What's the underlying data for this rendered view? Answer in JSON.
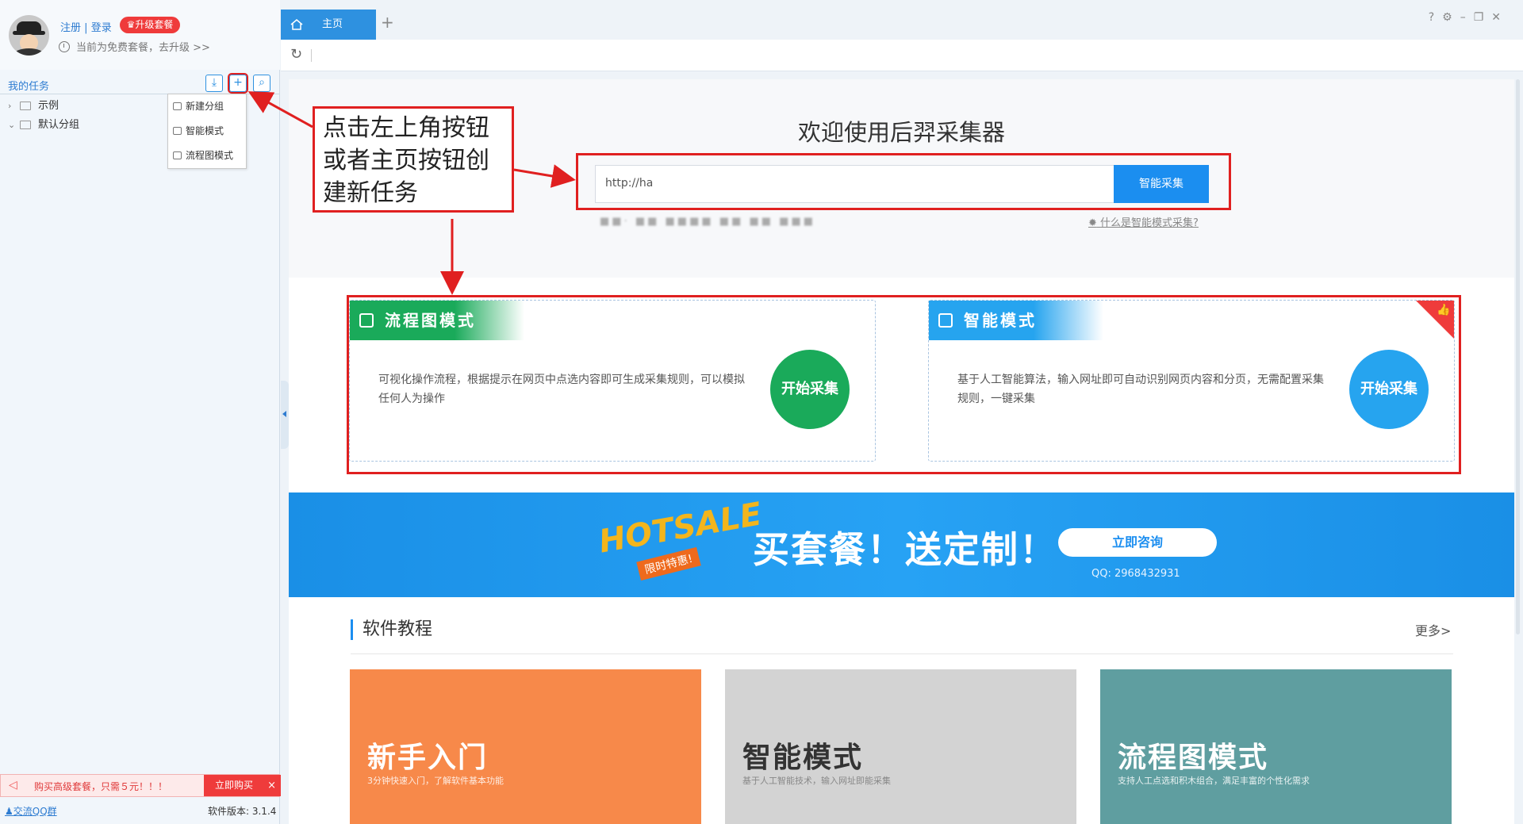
{
  "user": {
    "register": "注册",
    "sep": "|",
    "login": "登录",
    "upgrade": "升级套餐",
    "plan_text": "当前为免费套餐，去升级 >>"
  },
  "sidebar": {
    "title": "我的任务",
    "tools": [
      "import-icon",
      "add-task-icon",
      "search-icon"
    ],
    "tree": [
      {
        "label": "示例"
      },
      {
        "label": "默认分组"
      }
    ],
    "context_menu": [
      "新建分组",
      "智能模式",
      "流程图模式"
    ],
    "promo_text": "购买高级套餐，只需５元！！！",
    "promo_buy": "立即购买",
    "promo_close": "×",
    "qq_group": "交流QQ群",
    "version": "软件版本: 3.1.4"
  },
  "tabs": {
    "home": "主页",
    "add": "+"
  },
  "window_controls": [
    "?",
    "⚙",
    "–",
    "❐",
    "✕"
  ],
  "hero": {
    "title": "欢迎使用后羿采集器",
    "url_value": "http://ha",
    "smart_button": "智能采集",
    "blurred_links": "■■·  ■■  ■■■■  ■■  ■■  ■■■",
    "what_link": "什么是智能模式采集?"
  },
  "modes": [
    {
      "title": "流程图模式",
      "desc": "可视化操作流程，根据提示在网页中点选内容即可生成采集规则，可以模拟任何人为操作",
      "button": "开始采集",
      "color": "#1aaa5a"
    },
    {
      "title": "智能模式",
      "desc": "基于人工智能算法，输入网址即可自动识别网页内容和分页，无需配置采集规则，一键采集",
      "button": "开始采集",
      "color": "#26a4ef"
    }
  ],
  "banner": {
    "hotsale": "HOTSALE",
    "hotsale_sub": "限时特惠!",
    "slogan": "买套餐！送定制！",
    "consult": "立即咨询",
    "qq": "QQ: 2968432931"
  },
  "tutorials": {
    "title": "软件教程",
    "more": "更多>",
    "cards": [
      {
        "title": "新手入门",
        "sub": "3分钟快速入门，了解软件基本功能",
        "color": "#f7894a"
      },
      {
        "title": "智能模式",
        "sub": "基于人工智能技术，输入网址即能采集",
        "color": "#d3d3d3"
      },
      {
        "title": "流程图模式",
        "sub": "支持人工点选和积木组合，满足丰富的个性化需求",
        "color": "#5f9ea0"
      }
    ]
  },
  "annotation": {
    "text": "点击左上角按钮或者主页按钮创建新任务"
  }
}
